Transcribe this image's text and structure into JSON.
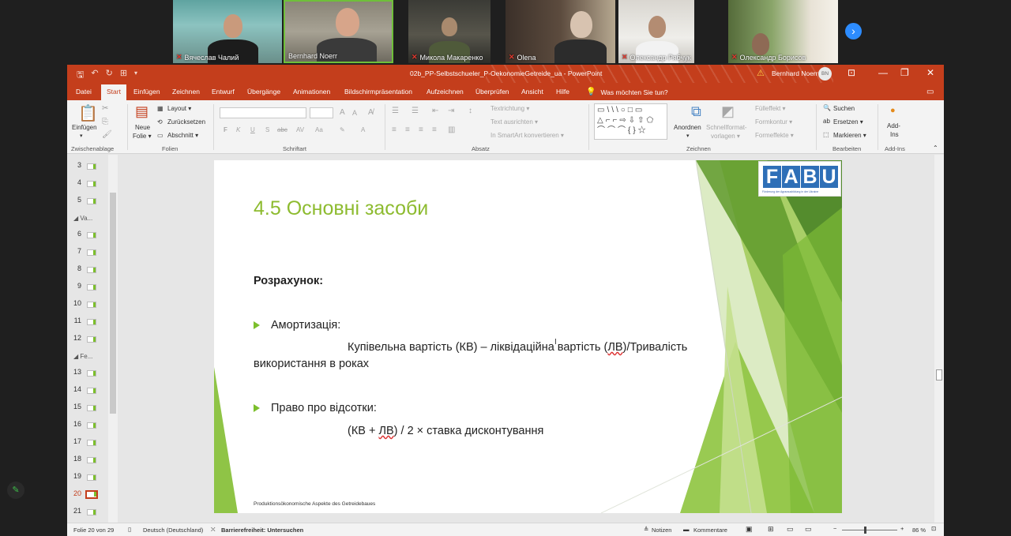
{
  "participants": [
    {
      "name": "Вячеслав Чалий",
      "muted": true
    },
    {
      "name": "Bernhard Noerr",
      "muted": false
    },
    {
      "name": "Микола Макаренко",
      "muted": true
    },
    {
      "name": "Olena",
      "muted": true
    },
    {
      "name": "Олександр Рябчук",
      "muted": true
    },
    {
      "name": "Олександр Борисов",
      "muted": true
    }
  ],
  "window": {
    "title": "02b_PP-Selbstschueler_P-OekonomieGetreide_ua  -  PowerPoint",
    "user": "Bernhard Noerr",
    "avatar_initials": "BN"
  },
  "tabs": [
    "Datei",
    "Start",
    "Einfügen",
    "Zeichnen",
    "Entwurf",
    "Übergänge",
    "Animationen",
    "Bildschirmpräsentation",
    "Aufzeichnen",
    "Überprüfen",
    "Ansicht",
    "Hilfe"
  ],
  "active_tab": "Start",
  "tell_me": "Was möchten Sie tun?",
  "ribbon": {
    "groups": [
      "Zwischenablage",
      "Folien",
      "Schriftart",
      "Absatz",
      "Zeichnen",
      "Bearbeiten",
      "Add-Ins"
    ],
    "paste": "Einfügen",
    "new_slide_1": "Neue",
    "new_slide_2": "Folie ▾",
    "layout": "Layout ▾",
    "reset": "Zurücksetzen",
    "section": "Abschnitt ▾",
    "text_direction": "Textrichtung ▾",
    "align_text": "Text ausrichten ▾",
    "smartart": "In SmartArt konvertieren ▾",
    "arrange": "Anordnen",
    "quick_styles_1": "Schnellformat-",
    "quick_styles_2": "vorlagen ▾",
    "fill": "Fülleffekt ▾",
    "outline": "Formkontur ▾",
    "effects": "Formeffekte ▾",
    "find": "Suchen",
    "replace": "Ersetzen ▾",
    "select": "Markieren ▾",
    "addins_1": "Add-",
    "addins_2": "Ins"
  },
  "thumbnails": [
    {
      "num": "3"
    },
    {
      "num": "4"
    },
    {
      "num": "5"
    },
    {
      "section": "◢  Va..."
    },
    {
      "num": "6"
    },
    {
      "num": "7"
    },
    {
      "num": "8"
    },
    {
      "num": "9"
    },
    {
      "num": "10"
    },
    {
      "num": "11"
    },
    {
      "num": "12"
    },
    {
      "section": "◢  Fe..."
    },
    {
      "num": "13"
    },
    {
      "num": "14"
    },
    {
      "num": "15"
    },
    {
      "num": "16"
    },
    {
      "num": "17"
    },
    {
      "num": "18"
    },
    {
      "num": "19"
    },
    {
      "num": "20",
      "current": true
    },
    {
      "num": "21"
    }
  ],
  "slide": {
    "title": "4.5 Основні засоби",
    "calc_label": "Розрахунок:",
    "bullet1": "Амортизація:",
    "formula1_a": "Купівельна вартість (КВ) – ліквідаційна вартість (",
    "formula1_ul": "ЛВ",
    "formula1_b": ")/Тривалість",
    "formula1_line2": "використання в роках",
    "bullet2": "Право про відсотки:",
    "formula2_a": "(КВ + ",
    "formula2_ul": "ЛВ",
    "formula2_b": ") / 2   ×  ставка дисконтування",
    "footer": "Produktionsökonomische Aspekte des Getreidebaues",
    "logo_letters": [
      "F",
      "A",
      "B",
      "U"
    ],
    "logo_colors": [
      "#2e6fb7",
      "#2e6fb7",
      "#2e6fb7",
      "#2e6fb7"
    ],
    "logo_subtitle": "Förderung der Agrarausbildung in der Ukraine"
  },
  "status": {
    "slide_info": "Folie 20 von 29",
    "language": "Deutsch (Deutschland)",
    "accessibility": "Barrierefreiheit: Untersuchen",
    "notes": "Notizen",
    "comments": "Kommentare",
    "zoom": "86 %"
  },
  "colors": {
    "ppt_accent": "#c43e1c",
    "slide_title_green": "#8dbb2f",
    "zoom_blue": "#2d8cff"
  }
}
